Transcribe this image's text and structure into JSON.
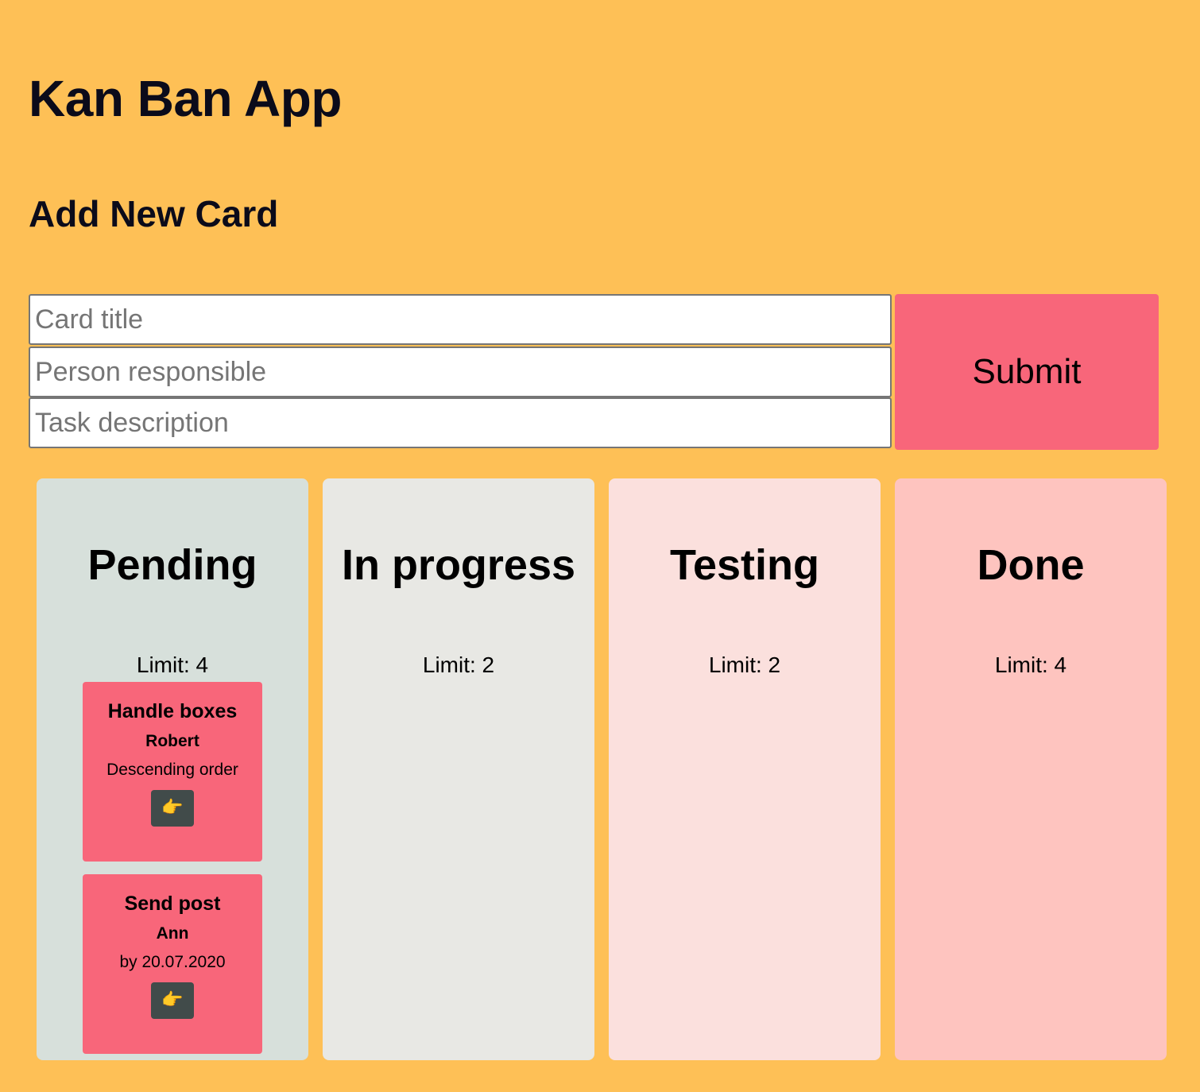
{
  "app": {
    "title": "Kan Ban App"
  },
  "form": {
    "heading": "Add New Card",
    "title_placeholder": "Card title",
    "person_placeholder": "Person responsible",
    "description_placeholder": "Task description",
    "submit_label": "Submit"
  },
  "columns": [
    {
      "title": "Pending",
      "limit_text": "Limit: 4",
      "cards": [
        {
          "title": "Handle boxes",
          "person": "Robert",
          "description": "Descending order",
          "move_icon": "👉"
        },
        {
          "title": "Send post",
          "person": "Ann",
          "description": "by 20.07.2020",
          "move_icon": "👉"
        }
      ]
    },
    {
      "title": "In progress",
      "limit_text": "Limit: 2",
      "cards": []
    },
    {
      "title": "Testing",
      "limit_text": "Limit: 2",
      "cards": []
    },
    {
      "title": "Done",
      "limit_text": "Limit: 4",
      "cards": []
    }
  ],
  "colors": {
    "background": "#FEC056",
    "accent": "#F8667A",
    "pending_bg": "#D7E0DB",
    "in_progress_bg": "#E8E8E4",
    "testing_bg": "#FBE0DD",
    "done_bg": "#FEC4BF",
    "move_button_bg": "#414B4A"
  }
}
